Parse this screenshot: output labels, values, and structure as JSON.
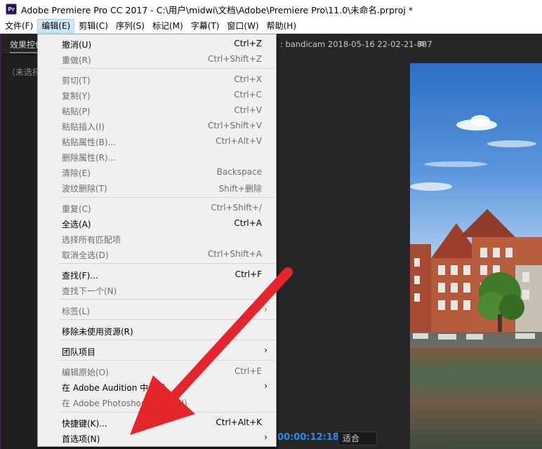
{
  "window": {
    "title": "Adobe Premiere Pro CC 2017 - C:\\用户\\midwi\\文档\\Adobe\\Premiere Pro\\11.0\\未命名.prproj *",
    "app_icon_text": "Pr"
  },
  "menubar": {
    "items": [
      "文件(F)",
      "编辑(E)",
      "剪辑(C)",
      "序列(S)",
      "标记(M)",
      "字幕(T)",
      "窗口(W)",
      "帮助(H)"
    ],
    "active_index": 1
  },
  "left_panel": {
    "tab_label": "效果控件",
    "no_clip_label": "（未选择剪辑）"
  },
  "right_panel": {
    "tab_label": ": bandicam 2018-05-16 22-02-21-887",
    "menu_icon": "hamburger-icon",
    "timecode": "00:00:12:18",
    "fit_label": "适合"
  },
  "edit_menu": {
    "items": [
      {
        "label": "撤消(U)",
        "shortcut": "Ctrl+Z",
        "enabled": true
      },
      {
        "label": "重做(R)",
        "shortcut": "Ctrl+Shift+Z",
        "enabled": false
      },
      {
        "label": "剪切(T)",
        "shortcut": "Ctrl+X",
        "enabled": false
      },
      {
        "label": "复制(Y)",
        "shortcut": "Ctrl+C",
        "enabled": false
      },
      {
        "label": "粘贴(P)",
        "shortcut": "Ctrl+V",
        "enabled": false
      },
      {
        "label": "粘贴插入(I)",
        "shortcut": "Ctrl+Shift+V",
        "enabled": false
      },
      {
        "label": "粘贴属性(B)...",
        "shortcut": "Ctrl+Alt+V",
        "enabled": false
      },
      {
        "label": "删除属性(R)...",
        "shortcut": "",
        "enabled": false
      },
      {
        "label": "清除(E)",
        "shortcut": "Backspace",
        "enabled": false
      },
      {
        "label": "波纹删除(T)",
        "shortcut": "Shift+删除",
        "enabled": false
      },
      {
        "label": "重复(C)",
        "shortcut": "Ctrl+Shift+/",
        "enabled": false
      },
      {
        "label": "全选(A)",
        "shortcut": "Ctrl+A",
        "enabled": true
      },
      {
        "label": "选择所有匹配项",
        "shortcut": "",
        "enabled": false
      },
      {
        "label": "取消全选(D)",
        "shortcut": "Ctrl+Shift+A",
        "enabled": false
      },
      {
        "label": "查找(F)...",
        "shortcut": "Ctrl+F",
        "enabled": true
      },
      {
        "label": "查找下一个(N)",
        "shortcut": "",
        "enabled": false
      },
      {
        "label": "标签(L)",
        "shortcut": "",
        "enabled": false,
        "submenu": true
      },
      {
        "label": "移除未使用资源(R)",
        "shortcut": "",
        "enabled": true
      },
      {
        "label": "团队项目",
        "shortcut": "",
        "enabled": true,
        "submenu": true
      },
      {
        "label": "编辑原始(O)",
        "shortcut": "Ctrl+E",
        "enabled": false
      },
      {
        "label": "在 Adobe Audition 中编辑",
        "shortcut": "",
        "enabled": true,
        "submenu": true
      },
      {
        "label": "在 Adobe Photoshop 中编辑(H)",
        "shortcut": "",
        "enabled": false
      },
      {
        "label": "快捷键(K)...",
        "shortcut": "Ctrl+Alt+K",
        "enabled": true
      },
      {
        "label": "首选项(N)",
        "shortcut": "",
        "enabled": true,
        "submenu": true
      }
    ]
  },
  "colors": {
    "annotation_arrow": "#e5242b",
    "timecode": "#2d8ceb",
    "menu_highlight": "#cce8ff"
  }
}
